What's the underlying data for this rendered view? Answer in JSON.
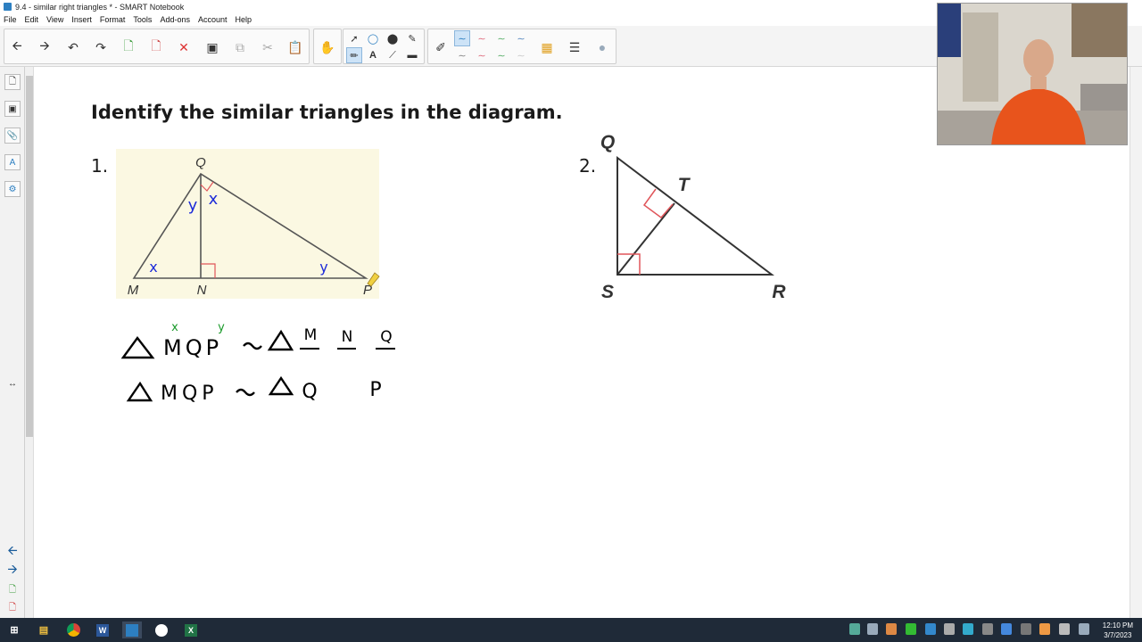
{
  "window": {
    "title": "9.4 - similar right triangles * - SMART Notebook"
  },
  "menu": [
    "File",
    "Edit",
    "View",
    "Insert",
    "Format",
    "Tools",
    "Add-ons",
    "Account",
    "Help"
  ],
  "page": {
    "heading": "Identify the similar triangles in the diagram.",
    "problem1": {
      "number": "1.",
      "labels": {
        "q": "Q",
        "m": "M",
        "n": "N",
        "p": "P",
        "y_angle_top": "y",
        "x_angle_top": "x",
        "x_angle_m": "x",
        "y_angle_p": "y"
      },
      "handwriting": {
        "line1_left": "MQP",
        "line1_marks": [
          "x",
          "y"
        ],
        "line1_right": [
          "M",
          "N",
          "Q"
        ],
        "line2_left": "MQP",
        "line2_right": [
          "Q",
          "P"
        ]
      }
    },
    "problem2": {
      "number": "2.",
      "labels": {
        "q": "Q",
        "t": "T",
        "s": "S",
        "r": "R"
      }
    }
  },
  "taskbar": {
    "time": "12:10 PM",
    "date": "3/7/2023"
  },
  "colors": {
    "accent": "#2d7fc1",
    "right_angle": "#e0555a",
    "figure_bg": "#fbf8e2",
    "ink_blue": "#1d2bd8",
    "ink_green": "#1a9a2a"
  }
}
